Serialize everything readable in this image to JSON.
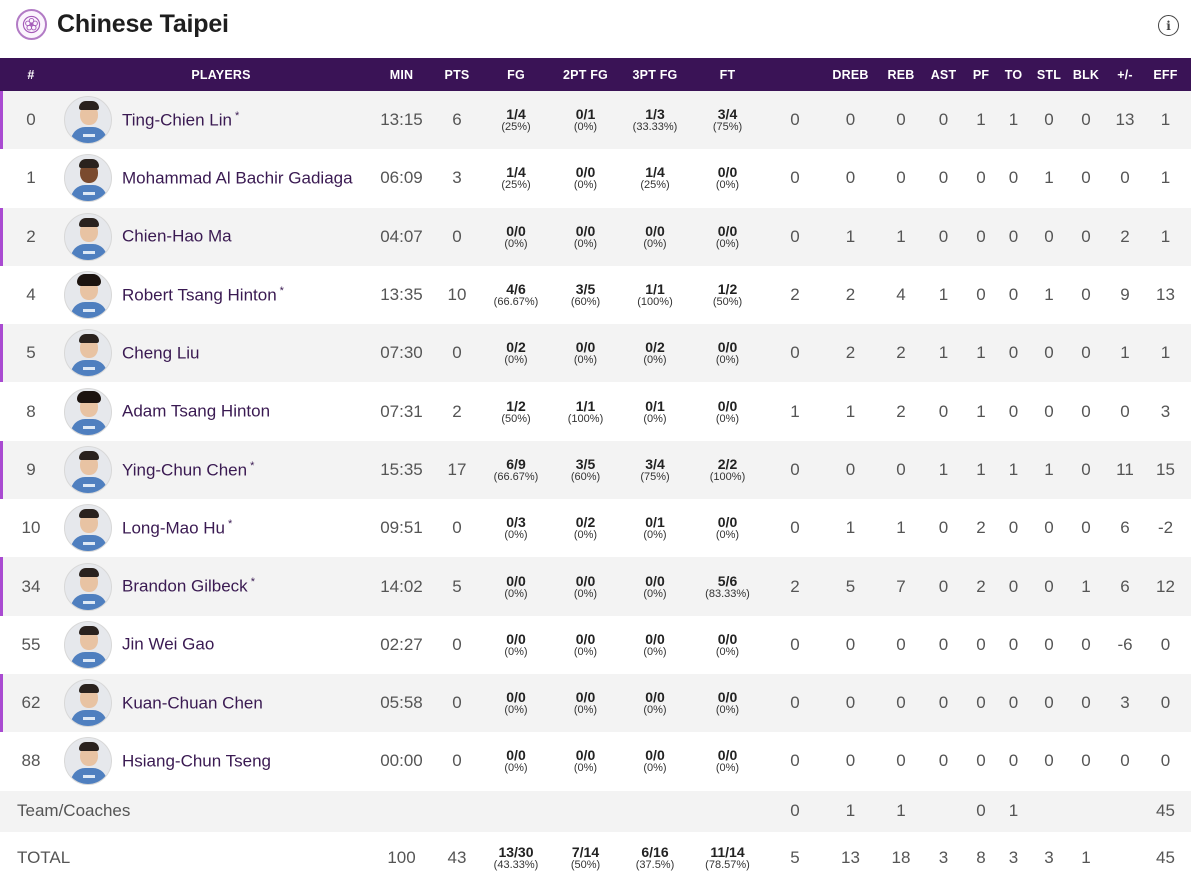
{
  "team": {
    "name": "Chinese Taipei"
  },
  "headers": [
    "#",
    "PLAYERS",
    "MIN",
    "PTS",
    "FG",
    "2PT FG",
    "3PT FG",
    "FT",
    "",
    "DREB",
    "REB",
    "AST",
    "PF",
    "TO",
    "STL",
    "BLK",
    "+/-",
    "EFF"
  ],
  "players": [
    {
      "no": "0",
      "name": "Ting-Chien Lin",
      "starter": "*",
      "min": "13:15",
      "pts": "6",
      "fg": [
        "1/4",
        "(25%)"
      ],
      "fg2": [
        "0/1",
        "(0%)"
      ],
      "fg3": [
        "1/3",
        "(33.33%)"
      ],
      "ft": [
        "3/4",
        "(75%)"
      ],
      "oreb": "0",
      "dreb": "0",
      "reb": "0",
      "ast": "0",
      "pf": "1",
      "to": "1",
      "stl": "0",
      "blk": "0",
      "pm": "13",
      "eff": "1"
    },
    {
      "no": "1",
      "name": "Mohammad Al Bachir Gadiaga",
      "starter": "",
      "min": "06:09",
      "pts": "3",
      "fg": [
        "1/4",
        "(25%)"
      ],
      "fg2": [
        "0/0",
        "(0%)"
      ],
      "fg3": [
        "1/4",
        "(25%)"
      ],
      "ft": [
        "0/0",
        "(0%)"
      ],
      "oreb": "0",
      "dreb": "0",
      "reb": "0",
      "ast": "0",
      "pf": "0",
      "to": "0",
      "stl": "1",
      "blk": "0",
      "pm": "0",
      "eff": "1"
    },
    {
      "no": "2",
      "name": "Chien-Hao Ma",
      "starter": "",
      "min": "04:07",
      "pts": "0",
      "fg": [
        "0/0",
        "(0%)"
      ],
      "fg2": [
        "0/0",
        "(0%)"
      ],
      "fg3": [
        "0/0",
        "(0%)"
      ],
      "ft": [
        "0/0",
        "(0%)"
      ],
      "oreb": "0",
      "dreb": "1",
      "reb": "1",
      "ast": "0",
      "pf": "0",
      "to": "0",
      "stl": "0",
      "blk": "0",
      "pm": "2",
      "eff": "1"
    },
    {
      "no": "4",
      "name": "Robert Tsang Hinton",
      "starter": "*",
      "min": "13:35",
      "pts": "10",
      "fg": [
        "4/6",
        "(66.67%)"
      ],
      "fg2": [
        "3/5",
        "(60%)"
      ],
      "fg3": [
        "1/1",
        "(100%)"
      ],
      "ft": [
        "1/2",
        "(50%)"
      ],
      "oreb": "2",
      "dreb": "2",
      "reb": "4",
      "ast": "1",
      "pf": "0",
      "to": "0",
      "stl": "1",
      "blk": "0",
      "pm": "9",
      "eff": "13"
    },
    {
      "no": "5",
      "name": "Cheng Liu",
      "starter": "",
      "min": "07:30",
      "pts": "0",
      "fg": [
        "0/2",
        "(0%)"
      ],
      "fg2": [
        "0/0",
        "(0%)"
      ],
      "fg3": [
        "0/2",
        "(0%)"
      ],
      "ft": [
        "0/0",
        "(0%)"
      ],
      "oreb": "0",
      "dreb": "2",
      "reb": "2",
      "ast": "1",
      "pf": "1",
      "to": "0",
      "stl": "0",
      "blk": "0",
      "pm": "1",
      "eff": "1"
    },
    {
      "no": "8",
      "name": "Adam Tsang Hinton",
      "starter": "",
      "min": "07:31",
      "pts": "2",
      "fg": [
        "1/2",
        "(50%)"
      ],
      "fg2": [
        "1/1",
        "(100%)"
      ],
      "fg3": [
        "0/1",
        "(0%)"
      ],
      "ft": [
        "0/0",
        "(0%)"
      ],
      "oreb": "1",
      "dreb": "1",
      "reb": "2",
      "ast": "0",
      "pf": "1",
      "to": "0",
      "stl": "0",
      "blk": "0",
      "pm": "0",
      "eff": "3"
    },
    {
      "no": "9",
      "name": "Ying-Chun Chen",
      "starter": "*",
      "min": "15:35",
      "pts": "17",
      "fg": [
        "6/9",
        "(66.67%)"
      ],
      "fg2": [
        "3/5",
        "(60%)"
      ],
      "fg3": [
        "3/4",
        "(75%)"
      ],
      "ft": [
        "2/2",
        "(100%)"
      ],
      "oreb": "0",
      "dreb": "0",
      "reb": "0",
      "ast": "1",
      "pf": "1",
      "to": "1",
      "stl": "1",
      "blk": "0",
      "pm": "11",
      "eff": "15"
    },
    {
      "no": "10",
      "name": "Long-Mao Hu",
      "starter": "*",
      "min": "09:51",
      "pts": "0",
      "fg": [
        "0/3",
        "(0%)"
      ],
      "fg2": [
        "0/2",
        "(0%)"
      ],
      "fg3": [
        "0/1",
        "(0%)"
      ],
      "ft": [
        "0/0",
        "(0%)"
      ],
      "oreb": "0",
      "dreb": "1",
      "reb": "1",
      "ast": "0",
      "pf": "2",
      "to": "0",
      "stl": "0",
      "blk": "0",
      "pm": "6",
      "eff": "-2"
    },
    {
      "no": "34",
      "name": "Brandon Gilbeck",
      "starter": "*",
      "min": "14:02",
      "pts": "5",
      "fg": [
        "0/0",
        "(0%)"
      ],
      "fg2": [
        "0/0",
        "(0%)"
      ],
      "fg3": [
        "0/0",
        "(0%)"
      ],
      "ft": [
        "5/6",
        "(83.33%)"
      ],
      "oreb": "2",
      "dreb": "5",
      "reb": "7",
      "ast": "0",
      "pf": "2",
      "to": "0",
      "stl": "0",
      "blk": "1",
      "pm": "6",
      "eff": "12"
    },
    {
      "no": "55",
      "name": "Jin Wei Gao",
      "starter": "",
      "min": "02:27",
      "pts": "0",
      "fg": [
        "0/0",
        "(0%)"
      ],
      "fg2": [
        "0/0",
        "(0%)"
      ],
      "fg3": [
        "0/0",
        "(0%)"
      ],
      "ft": [
        "0/0",
        "(0%)"
      ],
      "oreb": "0",
      "dreb": "0",
      "reb": "0",
      "ast": "0",
      "pf": "0",
      "to": "0",
      "stl": "0",
      "blk": "0",
      "pm": "-6",
      "eff": "0"
    },
    {
      "no": "62",
      "name": "Kuan-Chuan Chen",
      "starter": "",
      "min": "05:58",
      "pts": "0",
      "fg": [
        "0/0",
        "(0%)"
      ],
      "fg2": [
        "0/0",
        "(0%)"
      ],
      "fg3": [
        "0/0",
        "(0%)"
      ],
      "ft": [
        "0/0",
        "(0%)"
      ],
      "oreb": "0",
      "dreb": "0",
      "reb": "0",
      "ast": "0",
      "pf": "0",
      "to": "0",
      "stl": "0",
      "blk": "0",
      "pm": "3",
      "eff": "0"
    },
    {
      "no": "88",
      "name": "Hsiang-Chun Tseng",
      "starter": "",
      "min": "00:00",
      "pts": "0",
      "fg": [
        "0/0",
        "(0%)"
      ],
      "fg2": [
        "0/0",
        "(0%)"
      ],
      "fg3": [
        "0/0",
        "(0%)"
      ],
      "ft": [
        "0/0",
        "(0%)"
      ],
      "oreb": "0",
      "dreb": "0",
      "reb": "0",
      "ast": "0",
      "pf": "0",
      "to": "0",
      "stl": "0",
      "blk": "0",
      "pm": "0",
      "eff": "0"
    }
  ],
  "team_row": {
    "label": "Team/Coaches",
    "oreb": "0",
    "dreb": "1",
    "reb": "1",
    "pf": "0",
    "to": "1",
    "eff": "45"
  },
  "total_row": {
    "label": "TOTAL",
    "min": "100",
    "pts": "43",
    "fg": [
      "13/30",
      "(43.33%)"
    ],
    "fg2": [
      "7/14",
      "(50%)"
    ],
    "fg3": [
      "6/16",
      "(37.5%)"
    ],
    "ft": [
      "11/14",
      "(78.57%)"
    ],
    "oreb": "5",
    "dreb": "13",
    "reb": "18",
    "ast": "3",
    "pf": "8",
    "to": "3",
    "stl": "3",
    "blk": "1",
    "eff": "45"
  },
  "icons": {
    "team_logo": "plum-blossom-emblem-icon",
    "info": "info-circle-icon"
  },
  "colors": {
    "header_bg": "#3a1356",
    "starter_accent": "#a94ad1",
    "player_name": "#3a1a52"
  }
}
